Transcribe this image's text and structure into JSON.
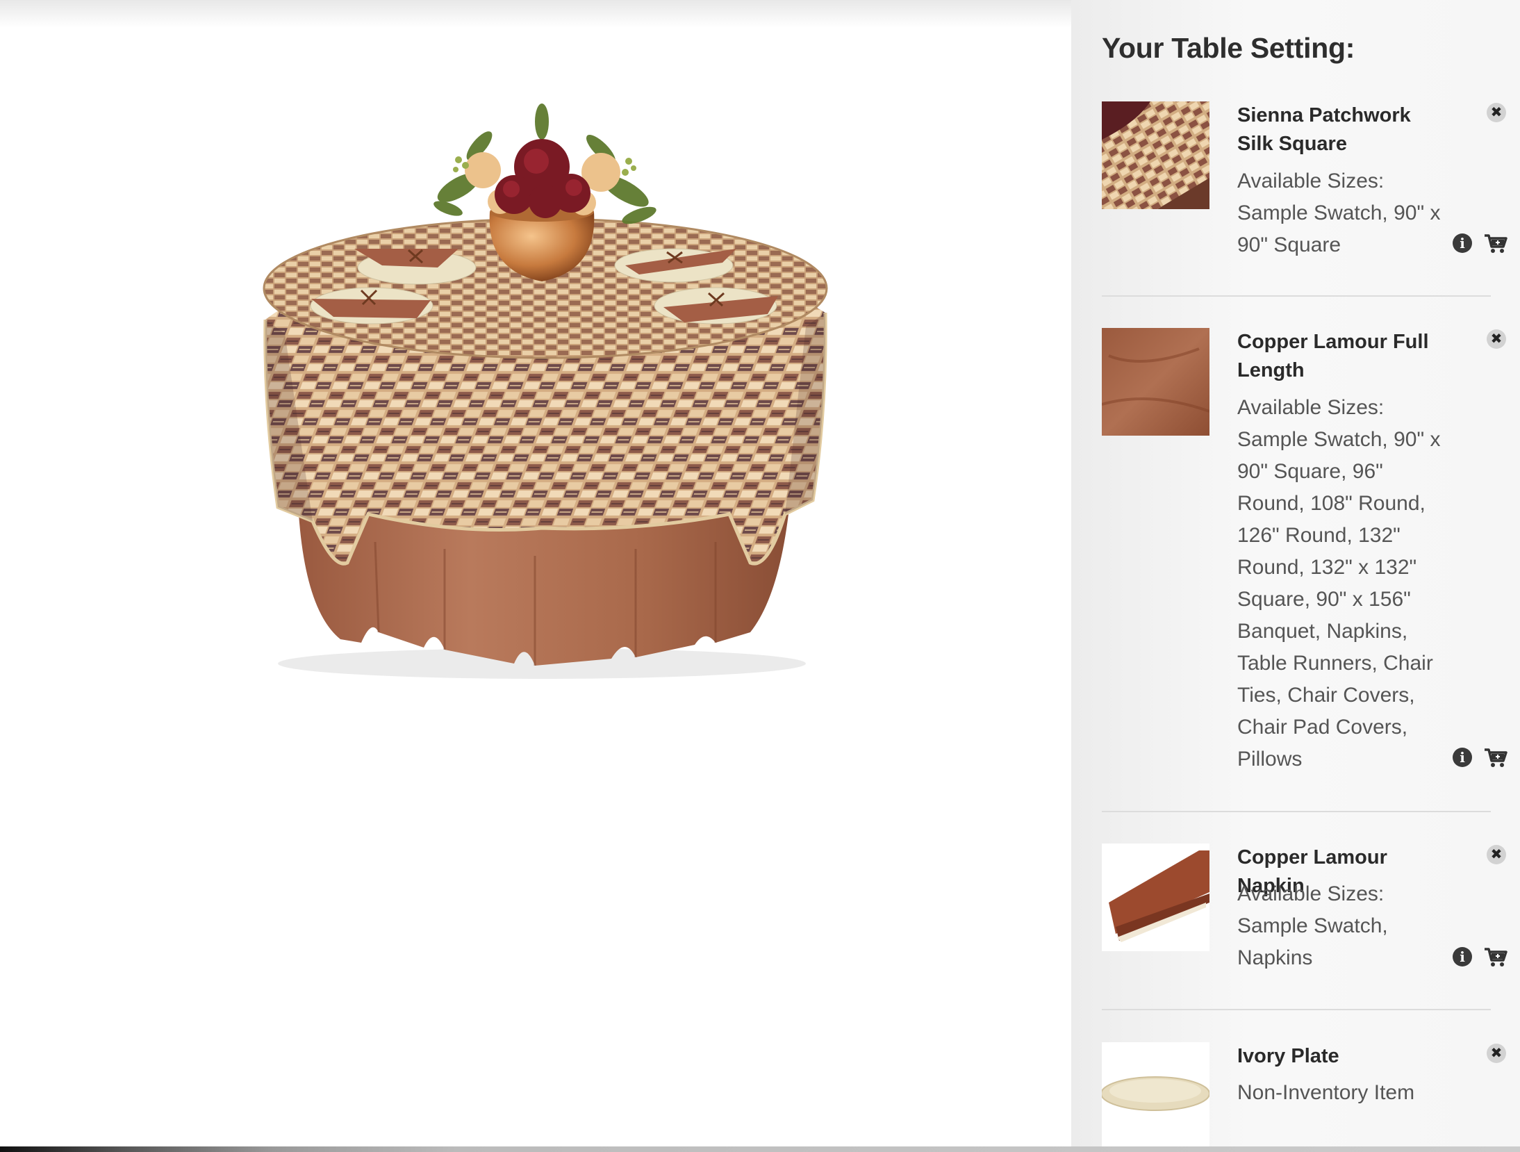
{
  "sidebar": {
    "title": "Your Table Setting:",
    "items": [
      {
        "name": "Sienna Patchwork Silk Square",
        "label": "Available Sizes:",
        "sizes": "Sample Swatch, 90\" x 90\" Square",
        "thumbnail": "patchwork-swatch"
      },
      {
        "name": "Copper Lamour Full Length",
        "label": "Available Sizes:",
        "sizes": "Sample Swatch, 90\" x 90\" Square, 96\" Round, 108\" Round, 126\" Round, 132\" Round, 132\" x 132\" Square, 90\" x 156\" Banquet, Napkins, Table Runners, Chair Ties, Chair Covers, Chair Pad Covers, Pillows",
        "thumbnail": "copper-swatch"
      },
      {
        "name": "Copper Lamour Napkin",
        "label": "Available Sizes:",
        "sizes": "Sample Swatch, Napkins",
        "thumbnail": "napkin-swatch"
      },
      {
        "name": "Ivory Plate",
        "label": "Non-Inventory Item",
        "thumbnail": "ivory-plate"
      }
    ]
  },
  "colors": {
    "copper": "#a8684c",
    "patchwork": "#c9a177",
    "ivory_plate": "#ebe3c8",
    "sidebar_bg": "#f5f5f5"
  },
  "icons": {
    "remove": "close-icon",
    "info": "info-icon",
    "cart": "add-to-cart-icon"
  }
}
